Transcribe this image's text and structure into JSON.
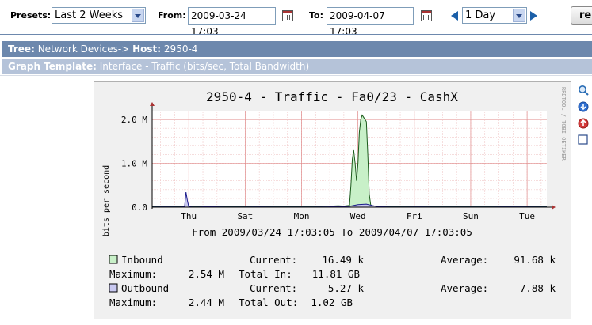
{
  "toolbar": {
    "presets_label": "Presets:",
    "presets_value": "Last 2 Weeks",
    "from_label": "From:",
    "from_value": "2009-03-24 17:03",
    "to_label": "To:",
    "to_value": "2009-04-07 17:03",
    "span_value": "1 Day",
    "refresh_label": "re"
  },
  "breadcrumb": {
    "tree_label": "Tree:",
    "tree_path": "Network Devices->",
    "host_label": "Host:",
    "host_value": "2950-4"
  },
  "template": {
    "label": "Graph Template:",
    "value": "Interface - Traffic (bits/sec, Total Bandwidth)"
  },
  "chart_data": {
    "type": "area",
    "title": "2950-4 - Traffic - Fa0/23 - CashX",
    "ylabel": "bits per second",
    "watermark": "RRDTOOL / TOBI OETIKER",
    "ylim": [
      0,
      2200000
    ],
    "yticks": [
      {
        "value": 0,
        "label": "0.0"
      },
      {
        "value": 1000000,
        "label": "1.0 M"
      },
      {
        "value": 2000000,
        "label": "2.0 M"
      }
    ],
    "xlim": [
      0,
      14
    ],
    "xticks": [
      {
        "value": 1.3,
        "label": "Thu"
      },
      {
        "value": 3.3,
        "label": "Sat"
      },
      {
        "value": 5.3,
        "label": "Mon"
      },
      {
        "value": 7.3,
        "label": "Wed"
      },
      {
        "value": 9.3,
        "label": "Fri"
      },
      {
        "value": 11.3,
        "label": "Sun"
      },
      {
        "value": 13.3,
        "label": "Tue"
      }
    ],
    "range_text": "From 2009/03/24 17:03:05 To 2009/04/07 17:03:05",
    "series": [
      {
        "name": "Inbound",
        "color": "#c8f0c8",
        "line_color": "#1a5a1a",
        "x": [
          0,
          0.5,
          1.0,
          1.6,
          2.0,
          2.6,
          3.2,
          3.8,
          4.4,
          5.0,
          5.6,
          6.2,
          6.6,
          6.8,
          7.0,
          7.05,
          7.1,
          7.15,
          7.2,
          7.25,
          7.3,
          7.35,
          7.4,
          7.45,
          7.5,
          7.55,
          7.6,
          7.65,
          7.7,
          7.75,
          7.8,
          8.0,
          8.5,
          9.0,
          9.5,
          10.0,
          10.5,
          11.0,
          11.5,
          12.0,
          12.5,
          13.0,
          13.5,
          14.0
        ],
        "values": [
          10000,
          20000,
          10000,
          15000,
          25000,
          10000,
          15000,
          10000,
          12000,
          10000,
          15000,
          20000,
          30000,
          25000,
          40000,
          500000,
          1100000,
          1300000,
          1000000,
          600000,
          1000000,
          1700000,
          2000000,
          2100000,
          2050000,
          2000000,
          1950000,
          1200000,
          300000,
          60000,
          20000,
          15000,
          10000,
          20000,
          10000,
          15000,
          10000,
          12000,
          10000,
          15000,
          10000,
          20000,
          10000,
          15000
        ]
      },
      {
        "name": "Outbound",
        "color": "#c8c8f0",
        "line_color": "#1a1a8a",
        "x": [
          0,
          0.5,
          1.0,
          1.15,
          1.2,
          1.25,
          1.3,
          1.4,
          1.6,
          2.0,
          2.6,
          3.2,
          3.8,
          4.4,
          5.0,
          5.6,
          6.2,
          7.0,
          7.3,
          7.6,
          7.8,
          8.0,
          8.5,
          9.0,
          9.5,
          10.0,
          11.0,
          12.0,
          13.0,
          14.0
        ],
        "values": [
          5000,
          8000,
          5000,
          10000,
          340000,
          150000,
          10000,
          8000,
          5000,
          10000,
          6000,
          5000,
          8000,
          5000,
          6000,
          5000,
          8000,
          20000,
          60000,
          70000,
          40000,
          10000,
          6000,
          5000,
          8000,
          5000,
          6000,
          5000,
          8000,
          5000
        ]
      }
    ],
    "legend": {
      "inbound": {
        "name": "Inbound",
        "current_label": "Current:",
        "current": "16.49 k",
        "average_label": "Average:",
        "average": "91.68 k",
        "maximum_label": "Maximum:",
        "maximum": "2.54 M",
        "total_label": "Total In:",
        "total": "11.81 GB"
      },
      "outbound": {
        "name": "Outbound",
        "current_label": "Current:",
        "current": "5.27 k",
        "average_label": "Average:",
        "average": "7.88 k",
        "maximum_label": "Maximum:",
        "maximum": "2.44 M",
        "total_label": "Total Out:",
        "total": "1.02 GB"
      }
    }
  },
  "side_icons": [
    "zoom-icon",
    "csv-export-icon",
    "properties-icon",
    "checkbox-icon"
  ]
}
